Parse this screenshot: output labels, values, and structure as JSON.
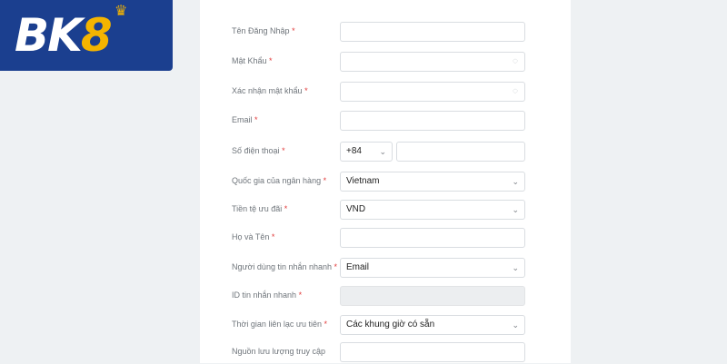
{
  "logo": {
    "text_main": "BK",
    "text_accent": "8"
  },
  "form": {
    "fields": [
      {
        "label": "Tên Đăng Nhập",
        "required": "*",
        "value": ""
      },
      {
        "label": "Mật Khẩu",
        "required": "*",
        "value": ""
      },
      {
        "label": "Xác nhận mật khẩu",
        "required": "*",
        "value": ""
      },
      {
        "label": "Email",
        "required": "*",
        "value": ""
      },
      {
        "label": "Số điện thoại",
        "required": "*",
        "code": "+84",
        "value": ""
      },
      {
        "label": "Quốc gia của ngân hàng",
        "required": "*",
        "value": "Vietnam"
      },
      {
        "label": "Tiền tệ ưu đãi",
        "required": "*",
        "value": "VND"
      },
      {
        "label": "Họ và Tên",
        "required": "*",
        "value": ""
      },
      {
        "label": "Người dùng tin nhắn nhanh",
        "required": "*",
        "value": "Email"
      },
      {
        "label": "ID tin nhắn nhanh",
        "required": "*",
        "value": ""
      },
      {
        "label": "Thời gian liên lạc ưu tiên",
        "required": "*",
        "value": "Các khung giờ có sẵn"
      },
      {
        "label": "Nguồn lưu lượng truy cập",
        "value": ""
      }
    ]
  },
  "icons": {
    "eye": "eye-off-icon",
    "chevron": "chevron-down-icon",
    "crown": "crown-icon"
  },
  "colors": {
    "brand": "#1b3f8f",
    "accent": "#f4b400",
    "required": "#e23b3b"
  }
}
